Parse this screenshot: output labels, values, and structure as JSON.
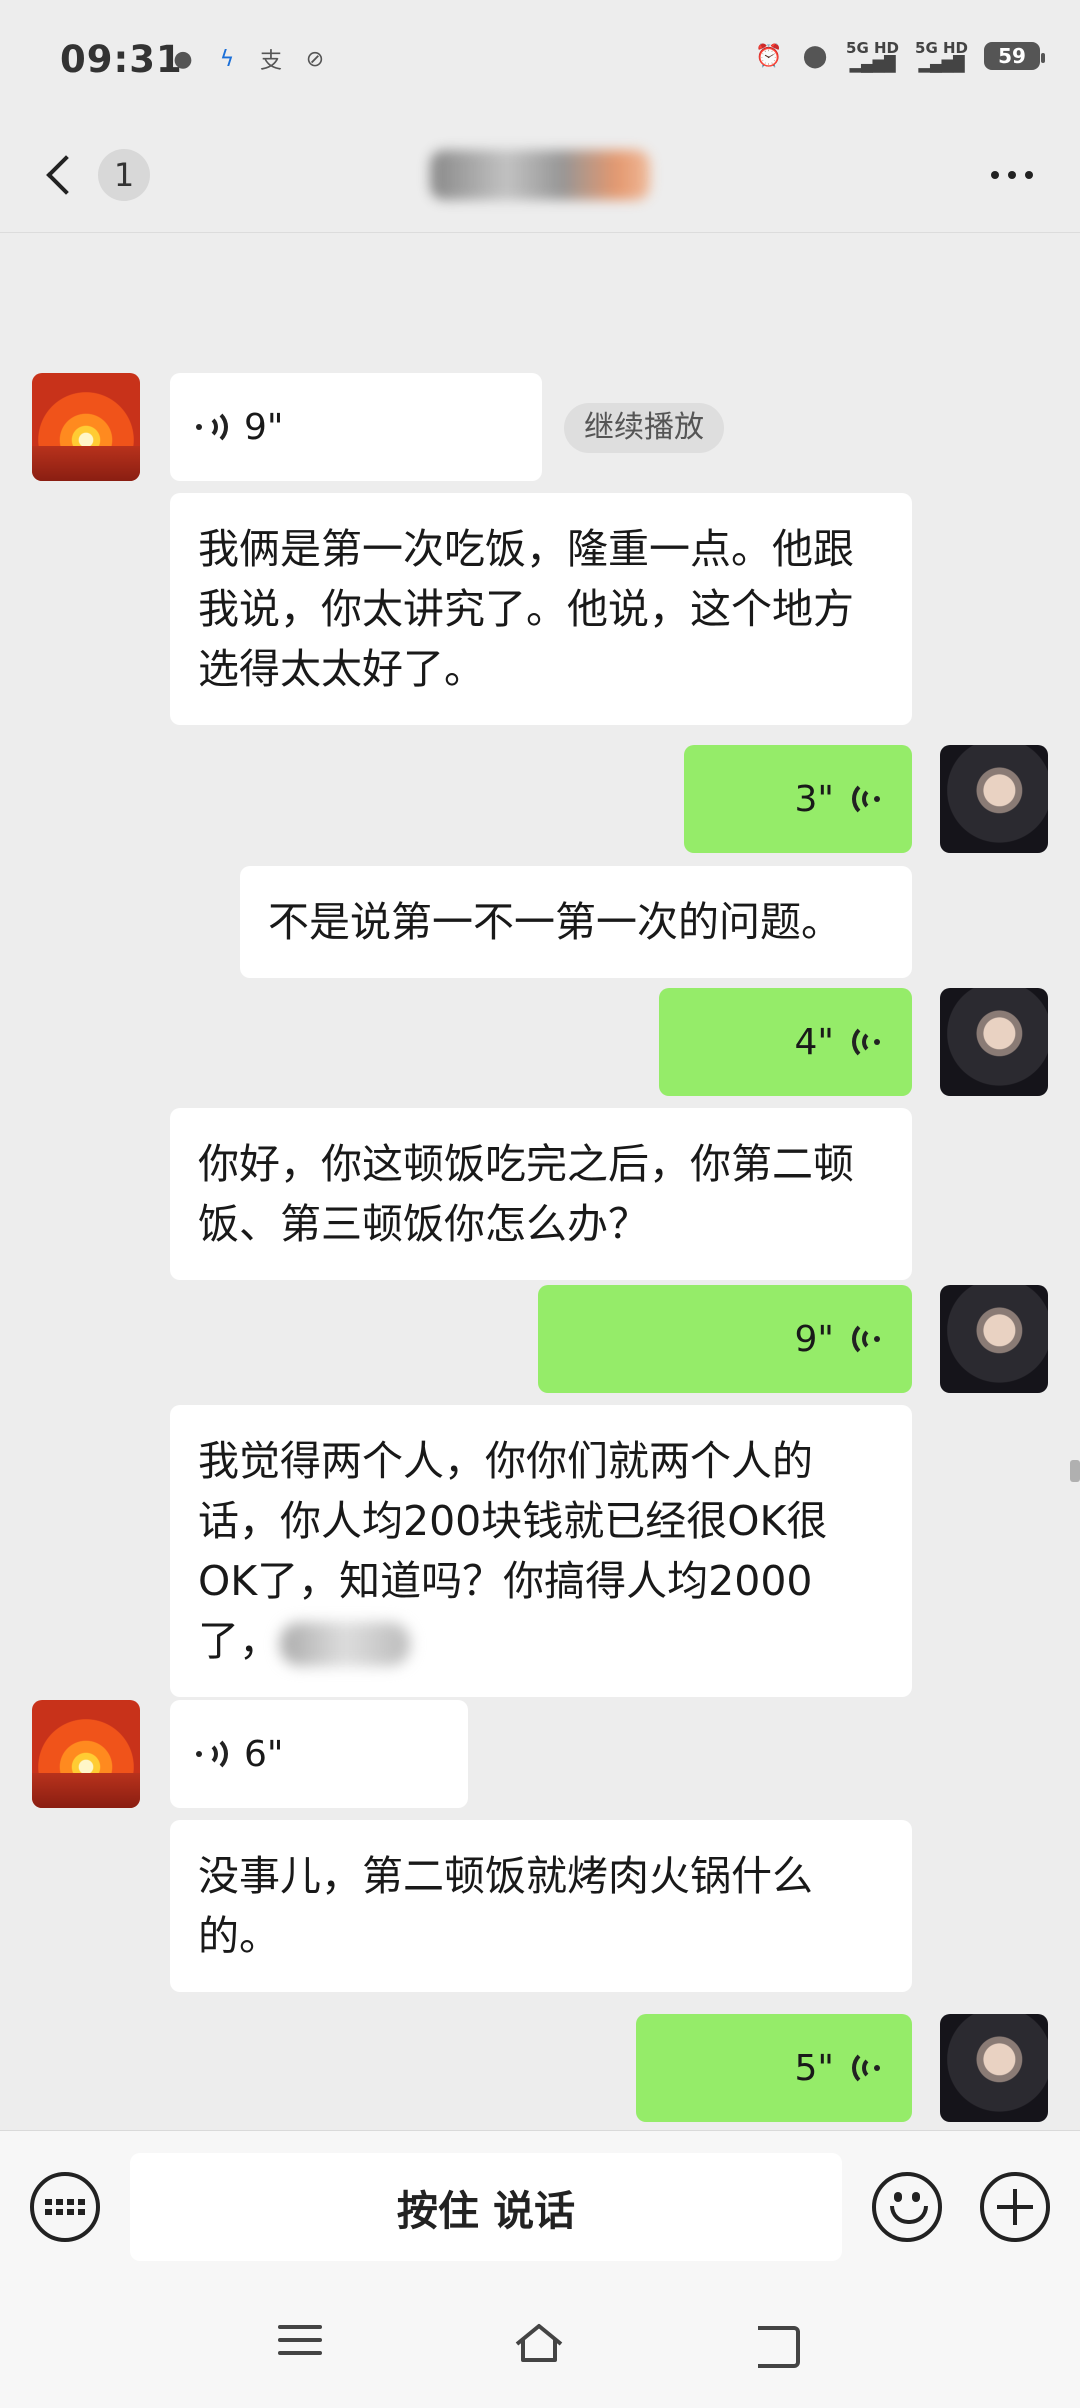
{
  "status_bar": {
    "time": "09:31",
    "left_icons": [
      "app-icon",
      "telecom-icon",
      "alipay-icon",
      "app-icon"
    ],
    "network_1": "5G HD",
    "network_2": "5G HD",
    "battery": "59"
  },
  "header": {
    "unread_count": "1",
    "title_blurred": "···",
    "more_icon": "more-dots-icon"
  },
  "messages": [
    {
      "side": "other",
      "kind": "voice",
      "duration": "9\""
    },
    {
      "side": "other",
      "kind": "text",
      "text": "我俩是第一次吃饭，隆重一点。他跟我说，你太讲究了。他说，这个地方选得太太好了。"
    },
    {
      "side": "me",
      "kind": "voice",
      "duration": "3\""
    },
    {
      "side": "me",
      "kind": "text",
      "text": "不是说第一不一第一次的问题。"
    },
    {
      "side": "me",
      "kind": "voice",
      "duration": "4\""
    },
    {
      "side": "me",
      "kind": "text",
      "text": "你好，你这顿饭吃完之后，你第二顿饭、第三顿饭你怎么办？"
    },
    {
      "side": "me",
      "kind": "voice",
      "duration": "9\""
    },
    {
      "side": "me",
      "kind": "text",
      "text": "我觉得两个人，你你们就两个人的话，你人均200块钱就已经很OK很OK了，知道吗？你搞得人均2000了，"
    },
    {
      "side": "other",
      "kind": "voice",
      "duration": "6\""
    },
    {
      "side": "other",
      "kind": "text",
      "text": "没事儿，第二顿饭就烤肉火锅什么的。"
    },
    {
      "side": "me",
      "kind": "voice",
      "duration": "5\""
    }
  ],
  "resume_label": "继续播放",
  "input_bar": {
    "hold_to_talk": "按住 说话"
  }
}
